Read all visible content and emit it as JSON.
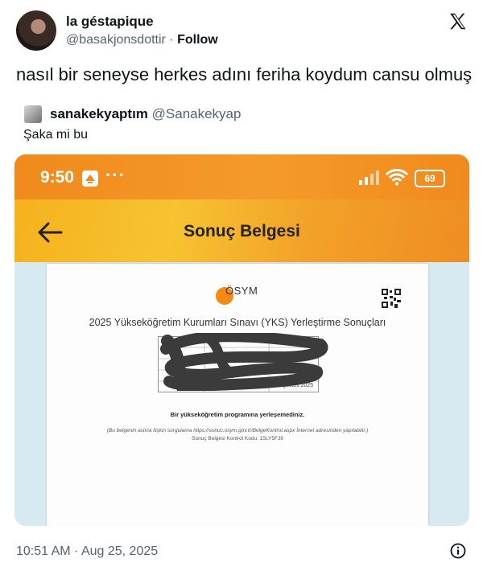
{
  "author": {
    "display_name": "la géstapique",
    "handle": "@basakjonsdottir",
    "separator": "·",
    "follow_label": "Follow"
  },
  "tweet": {
    "text": "nasıl bir seneyse herkes adını feriha koydum cansu olmuş",
    "timestamp": "10:51 AM · Aug 25, 2025"
  },
  "quote": {
    "display_name": "sanakekyaptım",
    "handle": "@Sanakekyap",
    "text": "Şaka mi bu"
  },
  "screenshot": {
    "status_time": "9:50",
    "dots": "···",
    "battery": "69",
    "app_title": "Sonuç Belgesi",
    "doc": {
      "logo_text": "ÖSYM",
      "title": "2025 Yükseköğretim Kurumları Sınavı (YKS) Yerleştirme Sonuçları",
      "date_label": "Sonuç Açıklama Tarihi",
      "date_value": "25 Ağustos 2025",
      "result_message": "Bir yükseköğretim programına yerleşemediniz.",
      "verify_note": "(Bu belgenin aslına ilişkin sorgulama https://sonuc.osym.gov.tr/BelgeKontrol.aspx İnternet adresinden yapılabilir.)",
      "control_code": "Sonuç Belgesi Kontrol Kodu: 15LY5FJ9"
    }
  },
  "colors": {
    "status_bar": "#f08a1c",
    "app_bar": "#f7c331",
    "media_bg": "#d7e9f1",
    "osym_orange": "#f28a13",
    "secondary_text": "#536471"
  },
  "icons": {
    "brand": "x-logo-icon",
    "back": "back-arrow-icon",
    "info": "info-icon",
    "wifi": "wifi-icon",
    "signal": "signal-icon",
    "qr": "qr-code-icon"
  }
}
